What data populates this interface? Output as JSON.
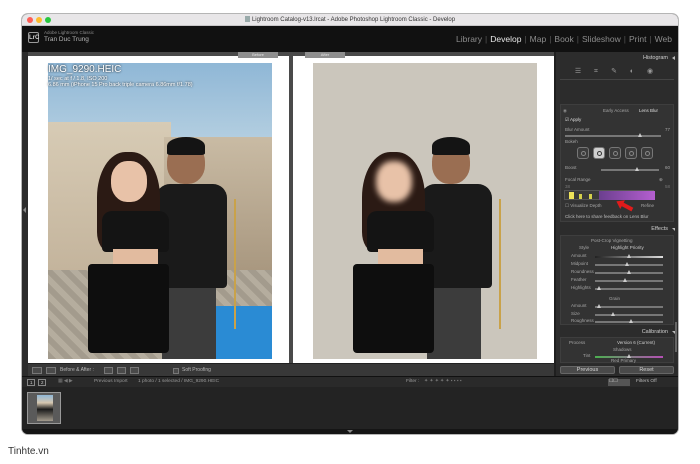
{
  "window": {
    "title": "Lightroom Catalog-v13.lrcat - Adobe Photoshop Lightroom Classic - Develop",
    "traffic_colors": [
      "#fe5f57",
      "#febc2e",
      "#28c840"
    ]
  },
  "identity": {
    "logo": "LrC",
    "product": "Adobe Lightroom Classic",
    "user": "Tran Duc Trung"
  },
  "modules": [
    {
      "label": "Library",
      "active": false
    },
    {
      "label": "Develop",
      "active": true
    },
    {
      "label": "Map",
      "active": false
    },
    {
      "label": "Book",
      "active": false
    },
    {
      "label": "Slideshow",
      "active": false
    },
    {
      "label": "Print",
      "active": false
    },
    {
      "label": "Web",
      "active": false
    }
  ],
  "compare": {
    "before_label": "Before",
    "after_label": "After"
  },
  "photo_info": {
    "filename": "IMG_9290.HEIC",
    "exposure": "1/ sec at f / 1.8, ISO 200",
    "lens": "6.86 mm (iPhone 15 Pro back triple camera 6.86mm f/1.78)"
  },
  "toolbar": {
    "before_after_label": "Before & After :",
    "soft_proofing": "Soft Proofing"
  },
  "right_panel": {
    "histogram_title": "Histogram",
    "lens_blur": {
      "early_access": "Early Access",
      "title": "Lens Blur",
      "apply": "Apply",
      "blur_amount_label": "Blur Amount",
      "blur_amount_value": "77",
      "bokeh_label": "Bokeh",
      "boost_label": "Boost",
      "boost_value": "60",
      "focal_range_label": "Focal Range",
      "focal_range_near": "38",
      "focal_range_far": "58",
      "visualize_depth": "Visualize Depth",
      "refine": "Refine",
      "feedback": "Click here to share feedback on Lens Blur"
    },
    "effects": {
      "title": "Effects",
      "post_crop_vignetting": "Post-Crop Vignetting",
      "style_label": "Style",
      "style_value": "Highlight Priority",
      "amount": "Amount",
      "midpoint": "Midpoint",
      "roundness": "Roundness",
      "feather": "Feather",
      "highlights": "Highlights",
      "grain": "Grain",
      "grain_amount": "Amount",
      "size": "Size",
      "roughness": "Roughness"
    },
    "calibration": {
      "title": "Calibration",
      "process_label": "Process",
      "process_value": "Version 6 (Current)",
      "shadows": "Shadows",
      "tint": "Tint",
      "red_primary": "Red Primary"
    },
    "buttons": {
      "previous": "Previous",
      "reset": "Reset"
    }
  },
  "filterbar": {
    "page1": "1",
    "page2": "2",
    "source": "Previous Import",
    "count": "1 photo / 1 selected / IMG_9290.HEIC",
    "filter_label": "Filter :",
    "filters_off": "Filters Off"
  },
  "watermark": "Tinhte.vn"
}
